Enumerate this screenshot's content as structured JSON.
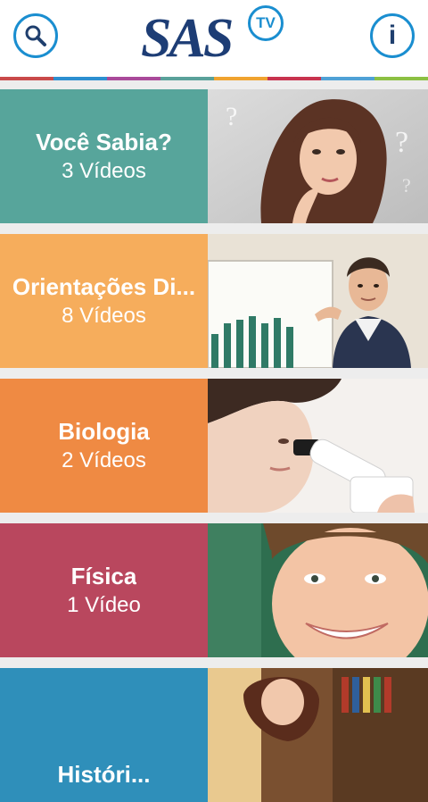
{
  "header": {
    "logo_text": "SAS",
    "logo_badge": "TV",
    "search_icon": "search-icon",
    "info_label": "i",
    "strip_colors": [
      "#c94a4a",
      "#2c8fd0",
      "#a94a9a",
      "#5aa19a",
      "#f0a330",
      "#c8334e",
      "#4fa1d6",
      "#8cc043"
    ]
  },
  "categories": [
    {
      "title": "Você Sabia?",
      "count": "3 Vídeos",
      "color": "#57a59b"
    },
    {
      "title": "Orientações Di...",
      "count": "8 Vídeos",
      "color": "#f6ad5c"
    },
    {
      "title": "Biologia",
      "count": "2 Vídeos",
      "color": "#ef8a43"
    },
    {
      "title": "Física",
      "count": "1 Vídeo",
      "color": "#b9475e"
    },
    {
      "title": "Históri...",
      "count": "",
      "color": "#2f8fba"
    }
  ]
}
